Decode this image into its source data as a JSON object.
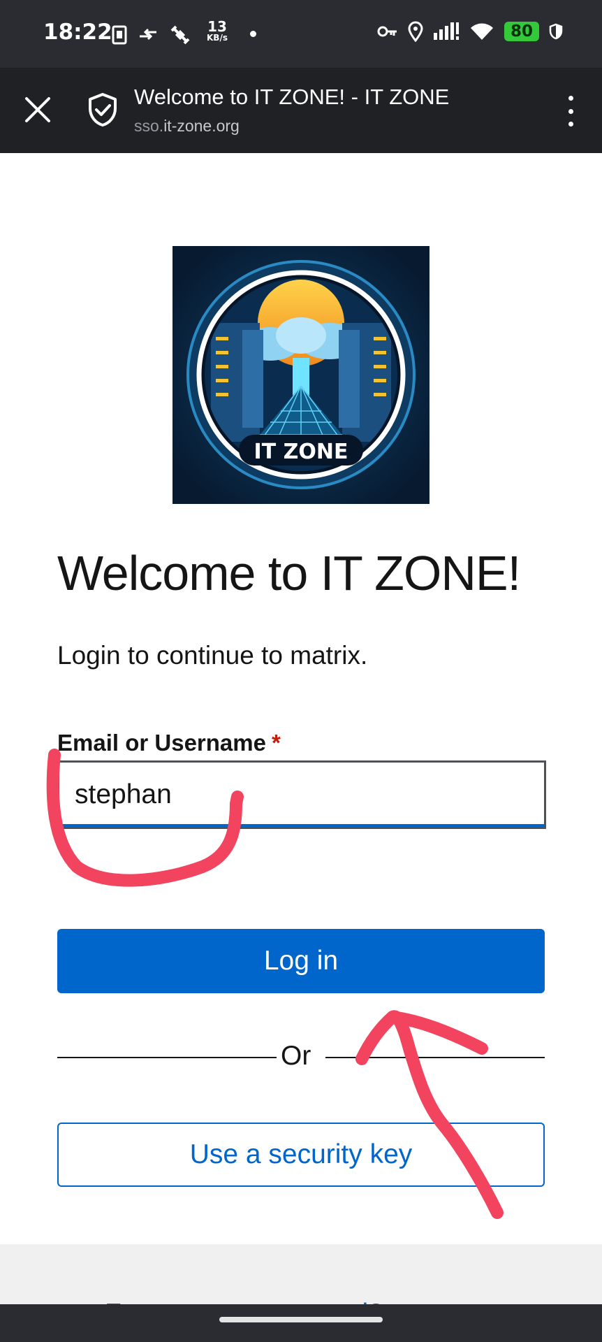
{
  "status_bar": {
    "time": "18:22",
    "speed_value": "13",
    "speed_unit": "KB/s",
    "battery": "80",
    "icons_left": [
      "sim-card-icon",
      "data-transfer-icon",
      "satellite-icon"
    ],
    "icons_right": [
      "vpn-key-icon",
      "location-icon",
      "signal-icon",
      "wifi-icon",
      "battery-icon",
      "shield-icon"
    ]
  },
  "browser": {
    "title": "Welcome to IT ZONE! - IT ZONE",
    "url_prefix": "sso.",
    "url_domain": "it-zone.org"
  },
  "logo": {
    "text": "IT ZONE"
  },
  "login": {
    "heading": "Welcome to IT ZONE!",
    "subtitle": "Login to continue to matrix.",
    "field_label": "Email or Username",
    "required_mark": "*",
    "username_value": "stephan",
    "login_button": "Log in",
    "divider_text": "Or",
    "security_key_button": "Use a security key"
  },
  "footer": {
    "forgot_link": "Forgot your password?"
  },
  "colors": {
    "primary": "#0066cc",
    "required": "#c9190b",
    "annotation": "#f2435f"
  }
}
